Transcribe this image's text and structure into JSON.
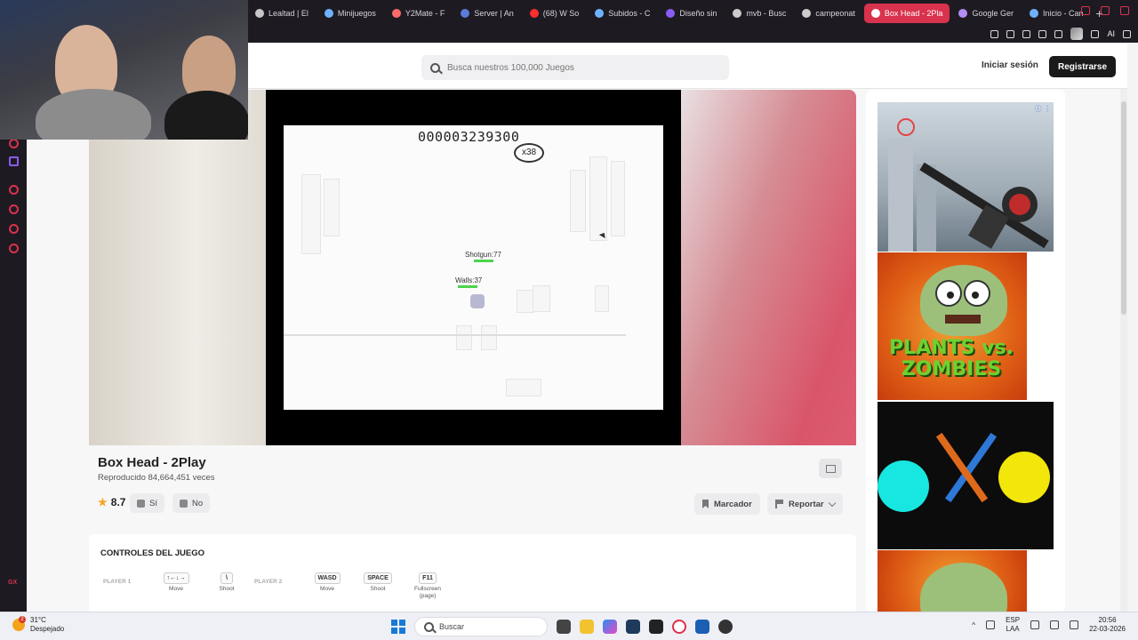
{
  "browser": {
    "tabs": [
      {
        "label": "Lealtad | El",
        "color": "#c7c7c7"
      },
      {
        "label": "Minijuegos",
        "color": "#6fb1ff"
      },
      {
        "label": "Y2Mate - F",
        "color": "#ff6b6b"
      },
      {
        "label": "Server | An",
        "color": "#5a7bd8"
      },
      {
        "label": "(68) W So",
        "color": "#ff2d2d"
      },
      {
        "label": "Subidos - C",
        "color": "#6fb1ff"
      },
      {
        "label": "Diseño sin",
        "color": "#8a5cf6"
      },
      {
        "label": "mvb - Busc",
        "color": "#cccccc"
      },
      {
        "label": "campeonat",
        "color": "#cccccc"
      },
      {
        "label": "Box Head - 2Pla",
        "color": "#ffffff"
      },
      {
        "label": "Google Ger",
        "color": "#b48cf5"
      },
      {
        "label": "Inicio - Can",
        "color": "#6fb1ff"
      }
    ],
    "active_tab_index": 9,
    "new_tab": "+",
    "ai_label": "AI",
    "sidebar_footer": "GX"
  },
  "header": {
    "search_placeholder": "Busca nuestros 100,000 Juegos",
    "login_label": "Iniciar sesión",
    "register_label": "Registrarse"
  },
  "game": {
    "score": "000003239300",
    "combo": "x38",
    "players": [
      {
        "name": "Shotgun:77"
      },
      {
        "name": "Walls:37"
      }
    ]
  },
  "info": {
    "title": "Box Head - 2Play",
    "plays": "Reproducido 84,664,451 veces",
    "rating": "8.7",
    "yes_label": "Sí",
    "no_label": "No",
    "bookmark_label": "Marcador",
    "report_label": "Reportar"
  },
  "controls": {
    "heading": "CONTROLES DEL JUEGO",
    "player1_label": "PLAYER 1",
    "player2_label": "PLAYER 2",
    "keys": [
      {
        "cap": "↑←↓→",
        "desc": "Move"
      },
      {
        "cap": "\\",
        "desc": "Shoot"
      },
      {
        "cap": "WASD",
        "desc": "Move"
      },
      {
        "cap": "SPACE",
        "desc": "Shoot"
      },
      {
        "cap": "F11",
        "desc": "Fullscreen (page)"
      }
    ]
  },
  "ads": {
    "pvz_title": "PLANTS vs. ZOMBIES"
  },
  "taskbar": {
    "temperature": "31°C",
    "weather": "Despejado",
    "weather_badge": "2",
    "search_label": "Buscar",
    "lang": "ESP",
    "lang_sub": "LAA",
    "time": "20:56",
    "date": "22-03-2026"
  }
}
